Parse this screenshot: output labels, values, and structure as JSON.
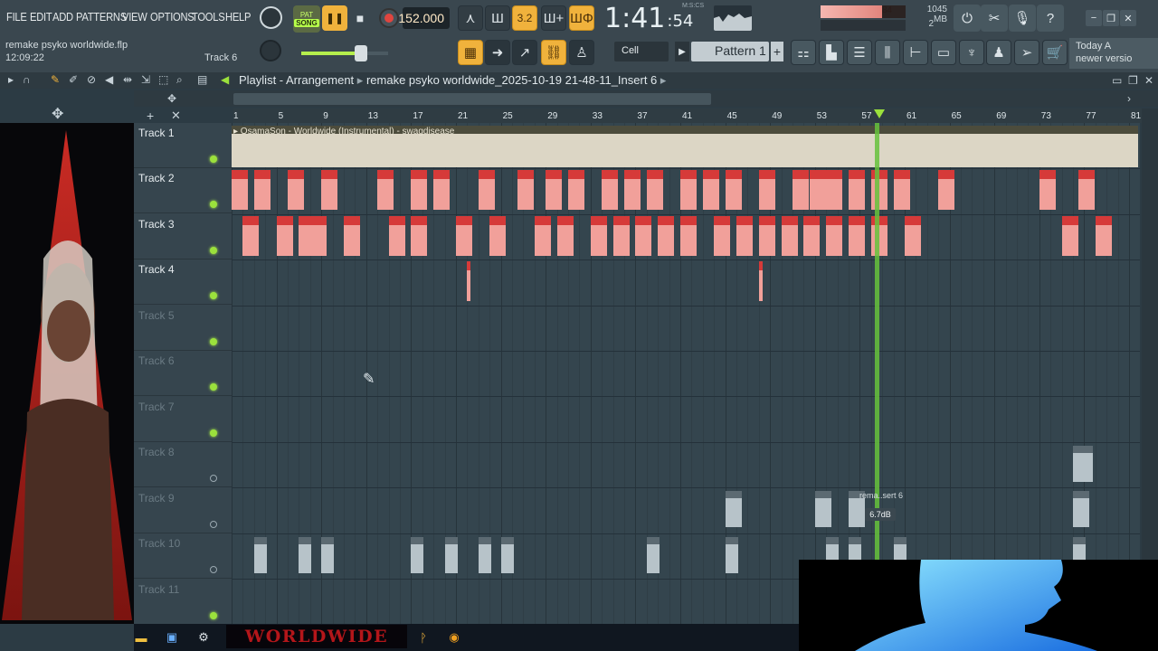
{
  "menu": [
    "FILE",
    "EDIT",
    "ADD",
    "PATTERNS",
    "VIEW",
    "OPTIONS",
    "TOOLS",
    "HELP"
  ],
  "transport": {
    "pat_label": "PAT",
    "song_label": "SONG",
    "tempo": "152.000",
    "time_main": "1:41",
    "time_sec": ":54",
    "time_format": "M:S:CS"
  },
  "toolbar": {
    "countdown_label": "3.2",
    "snap": "Cell",
    "pattern": "Pattern 1"
  },
  "status": {
    "cpu": "84",
    "memory": "1045 MB",
    "polyphony": "2"
  },
  "project": {
    "name": "remake psyko worldwide.flp",
    "time": "12:09:22",
    "track": "Track 6"
  },
  "news": {
    "line1": "Today  A",
    "line2": "newer versio"
  },
  "playlist": {
    "title": "Playlist - Arrangement",
    "crumb": "remake psyko worldwide_2025-10-19 21-48-11_Insert 6"
  },
  "ruler_ticks": [
    "1",
    "5",
    "9",
    "13",
    "17",
    "21",
    "25",
    "29",
    "33",
    "37",
    "41",
    "45",
    "49",
    "53",
    "57",
    "61",
    "65",
    "69",
    "73",
    "77",
    "81"
  ],
  "tracks": [
    {
      "name": "Track 1"
    },
    {
      "name": "Track 2"
    },
    {
      "name": "Track 3"
    },
    {
      "name": "Track 4"
    },
    {
      "name": "Track 5"
    },
    {
      "name": "Track 6"
    },
    {
      "name": "Track 7"
    },
    {
      "name": "Track 8"
    },
    {
      "name": "Track 9"
    },
    {
      "name": "Track 10"
    },
    {
      "name": "Track 11"
    }
  ],
  "clips": {
    "main_label": "▸ OsamaSon - Worldwide (Instrumental) - swagdisease",
    "insert_label": "rema..sert 6",
    "gain_tooltip": "6.7dB",
    "track2_bars": [
      1,
      3,
      6,
      9,
      14,
      17,
      19,
      23,
      26.5,
      29,
      31,
      34,
      36,
      38,
      41,
      43,
      45,
      48,
      51,
      52.5,
      54,
      56,
      58,
      60,
      64,
      73,
      76.5
    ],
    "track3_bars": [
      2,
      5,
      7,
      8,
      11,
      15,
      17,
      21,
      24,
      28,
      30,
      33,
      35,
      37,
      39,
      41,
      44,
      46,
      48,
      50,
      52,
      54,
      56,
      58,
      61,
      75,
      78
    ],
    "track4_bars": [
      22,
      48
    ],
    "track8_bars": [
      76
    ],
    "track9_bars": [
      45,
      53,
      56,
      76
    ],
    "track10_bars": [
      3,
      7,
      9,
      17,
      20,
      23,
      25,
      38,
      45,
      54,
      56,
      60,
      76
    ]
  },
  "banner": {
    "text": "WORLDWIDE"
  },
  "colors": {
    "accent": "#f0b23c",
    "clip_header": "#d63a39",
    "clip_body": "#f1a09a",
    "led": "#9be13c"
  }
}
